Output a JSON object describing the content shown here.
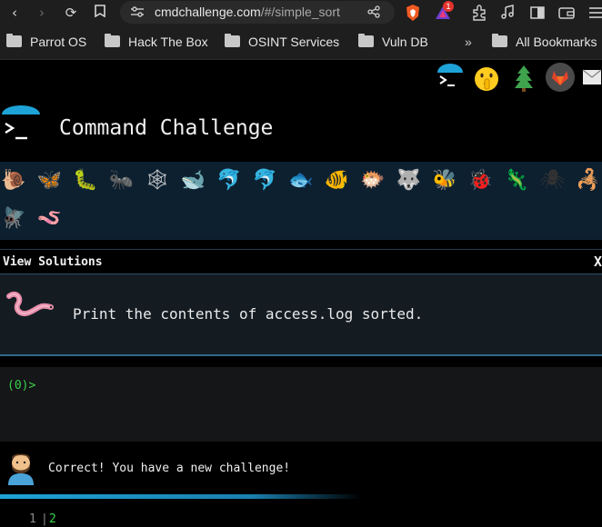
{
  "browser": {
    "url_host": "cmdchallenge.com",
    "url_path": "/#/simple_sort",
    "brave_badge": "1",
    "bookmarks": [
      {
        "label": "Parrot OS"
      },
      {
        "label": "Hack The Box"
      },
      {
        "label": "OSINT Services"
      },
      {
        "label": "Vuln DB"
      }
    ],
    "overflow_label": "»",
    "all_bookmarks_label": "All Bookmarks"
  },
  "page": {
    "title": "Command Challenge",
    "solutions_label": "View Solutions",
    "close_label": "X",
    "challenge_text": "Print the contents of access.log sorted.",
    "prompt": "(0)>",
    "feedback": "Correct! You have a new challenge!",
    "progress": 0.6,
    "output": {
      "line_no": "1",
      "separator": "|",
      "value": "2"
    }
  },
  "critters": [
    {
      "icon": "snail-icon",
      "glyph": "🐌",
      "color": "#b88a4a"
    },
    {
      "icon": "butterfly-icon",
      "glyph": "🦋",
      "color": "#e08a30"
    },
    {
      "icon": "caterpillar-icon",
      "glyph": "🐛",
      "color": "#7cc043"
    },
    {
      "icon": "ant-icon",
      "glyph": "🐜",
      "color": "#222222"
    },
    {
      "icon": "spider-web-icon",
      "glyph": "🕸",
      "color": "#cccccc"
    },
    {
      "icon": "whale-icon",
      "glyph": "🐋",
      "color": "#5aaee0"
    },
    {
      "icon": "dolphin-icon",
      "glyph": "🐬",
      "color": "#3da0d8"
    },
    {
      "icon": "dolphin-icon",
      "glyph": "🐬",
      "color": "#8fb6cc"
    },
    {
      "icon": "fish-icon",
      "glyph": "🐟",
      "color": "#4aa7e0"
    },
    {
      "icon": "tropical-fish-icon",
      "glyph": "🐠",
      "color": "#f2c12e"
    },
    {
      "icon": "blowfish-icon",
      "glyph": "🐡",
      "color": "#b07a3c"
    },
    {
      "icon": "wolf-icon",
      "glyph": "🐺",
      "color": "#9a9a9a"
    },
    {
      "icon": "bee-icon",
      "glyph": "🐝",
      "color": "#f2c12e"
    },
    {
      "icon": "ladybug-icon",
      "glyph": "🐞",
      "color": "#d83b3b"
    },
    {
      "icon": "lizard-icon",
      "glyph": "🦎",
      "color": "#6fb23a"
    },
    {
      "icon": "spider-icon",
      "glyph": "🕷",
      "color": "#333333"
    },
    {
      "icon": "scorpion-icon",
      "glyph": "🦂",
      "color": "#d06a2a"
    },
    {
      "icon": "fly-icon",
      "glyph": "🪰",
      "color": "#8e8e8e"
    },
    {
      "icon": "worm-icon",
      "glyph": "🪱",
      "color": "#e58ca8"
    }
  ],
  "colors": {
    "accent": "#1ea3d8",
    "prompt_green": "#39d24a",
    "critter_band": "#0d2030"
  }
}
